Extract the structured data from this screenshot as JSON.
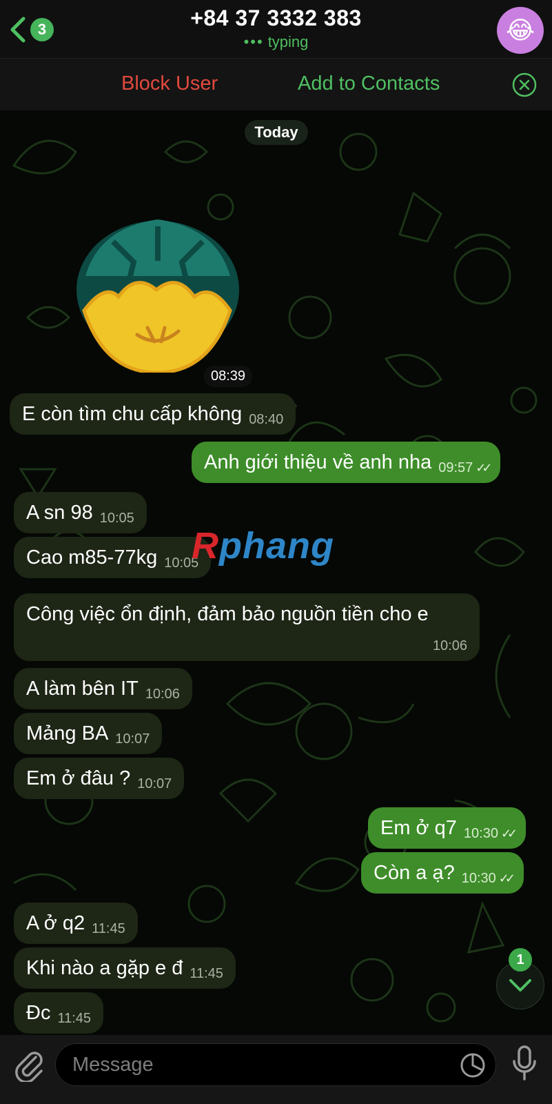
{
  "header": {
    "back_badge": "3",
    "title": "+84 37 3332 383",
    "status_dots": "•••",
    "status": "typing",
    "avatar_emoji": "😂"
  },
  "actions": {
    "block": "Block User",
    "add": "Add to Contacts"
  },
  "chat": {
    "date": "Today",
    "sticker_time": "08:39",
    "messages": [
      {
        "dir": "in",
        "text": "E còn tìm chu cấp không",
        "time": "08:40"
      },
      {
        "dir": "out",
        "text": "Anh giới thiệu về anh nha",
        "time": "09:57",
        "read": "✓✓"
      },
      {
        "dir": "in",
        "text": "A sn 98",
        "time": "10:05"
      },
      {
        "dir": "in",
        "text": "Cao m85-77kg",
        "time": "10:05"
      },
      {
        "dir": "in",
        "text": "Công việc ổn định, đảm bảo nguồn tiền cho e",
        "time": "10:06"
      },
      {
        "dir": "in",
        "text": "A làm bên IT",
        "time": "10:06"
      },
      {
        "dir": "in",
        "text": "Mảng BA",
        "time": "10:07"
      },
      {
        "dir": "in",
        "text": "Em ở đâu ?",
        "time": "10:07"
      },
      {
        "dir": "out",
        "text": "Em ở q7",
        "time": "10:30",
        "read": "✓✓"
      },
      {
        "dir": "out",
        "text": "Còn a ạ?",
        "time": "10:30",
        "read": "✓✓"
      },
      {
        "dir": "in",
        "text": "A ở q2",
        "time": "11:45"
      },
      {
        "dir": "in",
        "text": "Khi nào a gặp e đ",
        "time": "11:45"
      },
      {
        "dir": "in",
        "text": "Đc",
        "time": "11:45"
      }
    ],
    "unread_badge": "1"
  },
  "watermark": {
    "r": "R",
    "rest": "phang"
  },
  "input": {
    "placeholder": "Message"
  },
  "colors": {
    "accent_green": "#4fc062",
    "block_red": "#e2493f",
    "incoming_bubble": "#1e2616",
    "outgoing_bubble": "#3e8d2a"
  }
}
